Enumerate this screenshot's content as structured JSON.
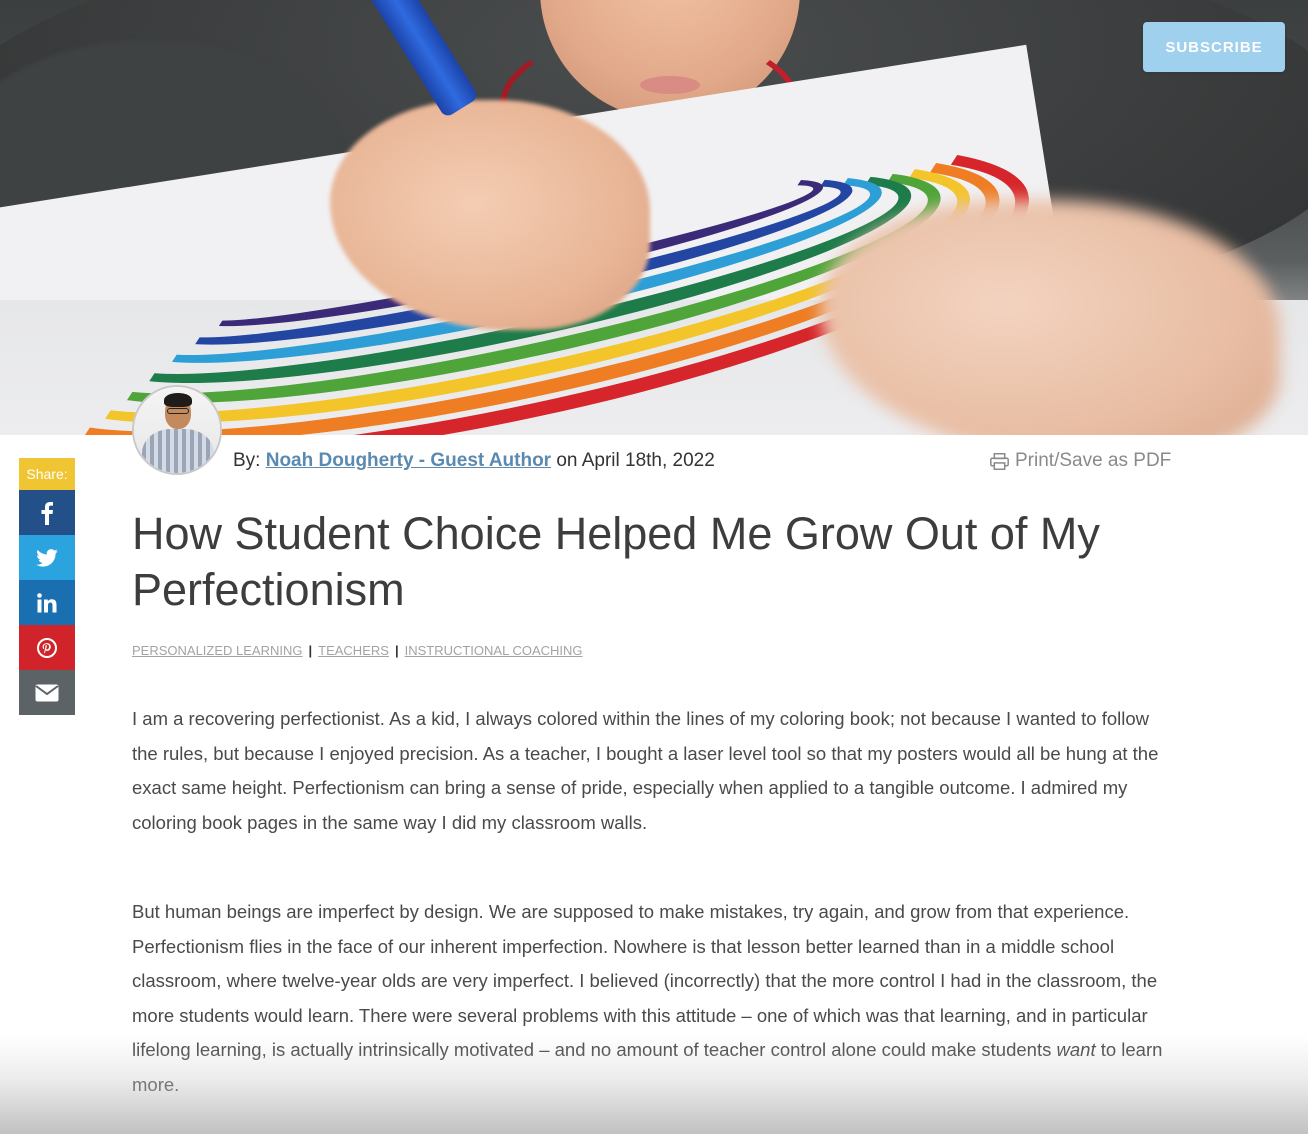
{
  "header": {
    "subscribe_label": "SUBSCRIBE"
  },
  "share": {
    "label": "Share:",
    "buttons": [
      {
        "icon": "facebook-icon",
        "color": "#24508a"
      },
      {
        "icon": "twitter-icon",
        "color": "#2aa3de"
      },
      {
        "icon": "linkedin-icon",
        "color": "#1a6fb0"
      },
      {
        "icon": "pinterest-icon",
        "color": "#d1232a"
      },
      {
        "icon": "email-icon",
        "color": "#5c6367"
      }
    ]
  },
  "article": {
    "byline_prefix": "By:",
    "author": "Noah Dougherty - Guest Author",
    "date_text": "on April 18th, 2022",
    "print_label": "Print/Save as PDF",
    "title": "How Student Choice Helped Me Grow Out of My Perfectionism",
    "tags": [
      "PERSONALIZED LEARNING",
      "TEACHERS",
      "INSTRUCTIONAL COACHING"
    ],
    "paragraph1": "I am a recovering perfectionist. As a kid, I always colored within the lines of my coloring book; not because I wanted to follow the rules, but because I enjoyed precision. As a teacher, I bought a laser level tool so that my posters would all be hung at the exact same height. Perfectionism can bring a sense of pride, especially when applied to a tangible outcome. I admired my coloring book pages in the same way I did my classroom walls.",
    "paragraph2_before": "But human beings are imperfect by design. We are supposed to make mistakes, try again, and grow from that experience. Perfectionism flies in the face of our inherent imperfection. Nowhere is that lesson better learned than in a middle school classroom, where twelve-year olds are very imperfect. I believed (incorrectly) that the more control I had in the classroom, the more students would learn. There were several problems with this attitude – one of which was that learning, and in particular lifelong learning, is actually intrinsically motivated – and no amount of teacher control alone could make students ",
    "paragraph2_emphasis": "want",
    "paragraph2_after": " to learn more."
  },
  "colors": {
    "subscribe_bg": "#9fd0ee",
    "author_link": "#5b8ab0",
    "share_label_bg": "#f0c533"
  }
}
